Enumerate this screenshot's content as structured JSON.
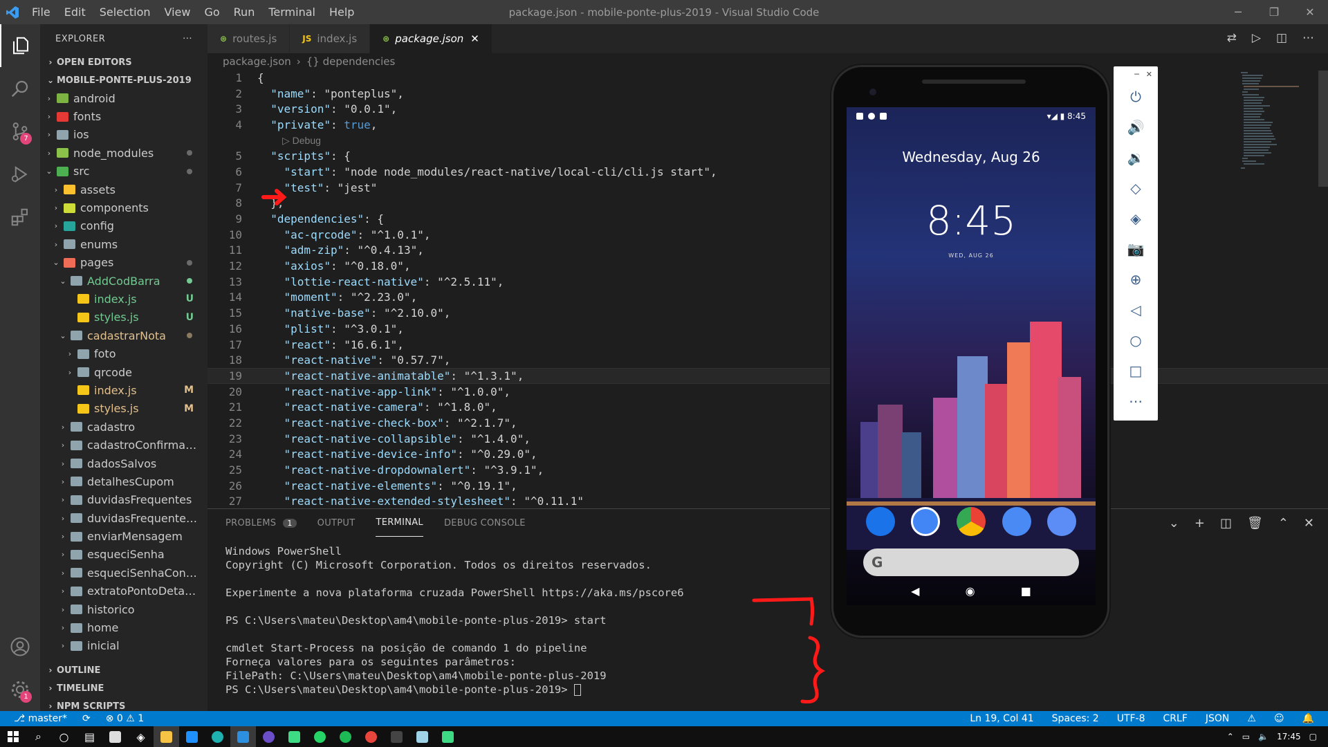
{
  "window": {
    "title": "package.json - mobile-ponte-plus-2019 - Visual Studio Code",
    "menu": [
      "File",
      "Edit",
      "Selection",
      "View",
      "Go",
      "Run",
      "Terminal",
      "Help"
    ]
  },
  "activity": {
    "scm_badge": "7",
    "settings_badge": "1"
  },
  "explorer": {
    "title": "EXPLORER",
    "more": "···",
    "open_editors": "OPEN EDITORS",
    "project": "MOBILE-PONTE-PLUS-2019",
    "tree": [
      {
        "label": "android",
        "depth": 1,
        "chev": "›",
        "icon": "#7cb342",
        "status": ""
      },
      {
        "label": "fonts",
        "depth": 1,
        "chev": "›",
        "icon": "#e53935",
        "status": ""
      },
      {
        "label": "ios",
        "depth": 1,
        "chev": "›",
        "icon": "#90a4ae",
        "status": ""
      },
      {
        "label": "node_modules",
        "depth": 1,
        "chev": "›",
        "icon": "#8bc34a",
        "status": "",
        "dot": true
      },
      {
        "label": "src",
        "depth": 1,
        "chev": "⌄",
        "icon": "#4caf50",
        "status": "",
        "dot": true
      },
      {
        "label": "assets",
        "depth": 2,
        "chev": "›",
        "icon": "#fbc02d",
        "status": ""
      },
      {
        "label": "components",
        "depth": 2,
        "chev": "›",
        "icon": "#cddc39",
        "status": ""
      },
      {
        "label": "config",
        "depth": 2,
        "chev": "›",
        "icon": "#26a69a",
        "status": ""
      },
      {
        "label": "enums",
        "depth": 2,
        "chev": "›",
        "icon": "#90a4ae",
        "status": ""
      },
      {
        "label": "pages",
        "depth": 2,
        "chev": "⌄",
        "icon": "#ef6c57",
        "status": "",
        "dot": true
      },
      {
        "label": "AddCodBarra",
        "depth": 3,
        "chev": "⌄",
        "icon": "#90a4ae",
        "status": "",
        "green": true,
        "dot": true
      },
      {
        "label": "index.js",
        "depth": 4,
        "chev": "",
        "icon": "#f5c518",
        "status": "U",
        "green": true
      },
      {
        "label": "styles.js",
        "depth": 4,
        "chev": "",
        "icon": "#f5c518",
        "status": "U",
        "green": true
      },
      {
        "label": "cadastrarNota",
        "depth": 3,
        "chev": "⌄",
        "icon": "#90a4ae",
        "status": "",
        "mod": true,
        "dot": true
      },
      {
        "label": "foto",
        "depth": 4,
        "chev": "›",
        "icon": "#90a4ae",
        "status": ""
      },
      {
        "label": "qrcode",
        "depth": 4,
        "chev": "›",
        "icon": "#90a4ae",
        "status": ""
      },
      {
        "label": "index.js",
        "depth": 4,
        "chev": "",
        "icon": "#f5c518",
        "status": "M",
        "mod": true
      },
      {
        "label": "styles.js",
        "depth": 4,
        "chev": "",
        "icon": "#f5c518",
        "status": "M",
        "mod": true
      },
      {
        "label": "cadastro",
        "depth": 3,
        "chev": "›",
        "icon": "#90a4ae",
        "status": ""
      },
      {
        "label": "cadastroConfirmacao",
        "depth": 3,
        "chev": "›",
        "icon": "#90a4ae",
        "status": ""
      },
      {
        "label": "dadosSalvos",
        "depth": 3,
        "chev": "›",
        "icon": "#90a4ae",
        "status": ""
      },
      {
        "label": "detalhesCupom",
        "depth": 3,
        "chev": "›",
        "icon": "#90a4ae",
        "status": ""
      },
      {
        "label": "duvidasFrequentes",
        "depth": 3,
        "chev": "›",
        "icon": "#90a4ae",
        "status": ""
      },
      {
        "label": "duvidasFrequentesIn...",
        "depth": 3,
        "chev": "›",
        "icon": "#90a4ae",
        "status": ""
      },
      {
        "label": "enviarMensagem",
        "depth": 3,
        "chev": "›",
        "icon": "#90a4ae",
        "status": ""
      },
      {
        "label": "esqueciSenha",
        "depth": 3,
        "chev": "›",
        "icon": "#90a4ae",
        "status": ""
      },
      {
        "label": "esqueciSenhaConfir...",
        "depth": 3,
        "chev": "›",
        "icon": "#90a4ae",
        "status": ""
      },
      {
        "label": "extratoPontoDetalhes",
        "depth": 3,
        "chev": "›",
        "icon": "#90a4ae",
        "status": ""
      },
      {
        "label": "historico",
        "depth": 3,
        "chev": "›",
        "icon": "#90a4ae",
        "status": ""
      },
      {
        "label": "home",
        "depth": 3,
        "chev": "›",
        "icon": "#90a4ae",
        "status": ""
      },
      {
        "label": "inicial",
        "depth": 3,
        "chev": "›",
        "icon": "#90a4ae",
        "status": ""
      }
    ],
    "outline": "OUTLINE",
    "timeline": "TIMELINE",
    "npm": "NPM SCRIPTS"
  },
  "tabs": [
    {
      "label": "routes.js",
      "icon": "⊛",
      "color": "#8bc34a",
      "active": false
    },
    {
      "label": "index.js",
      "icon": "JS",
      "color": "#f5c518",
      "active": false
    },
    {
      "label": "package.json",
      "icon": "⊛",
      "color": "#8bc34a",
      "active": true
    }
  ],
  "breadcrumb": [
    "package.json",
    "{} dependencies"
  ],
  "codelens": "▷ Debug",
  "code": [
    "{",
    "  \"name\": \"ponteplus\",",
    "  \"version\": \"0.0.1\",",
    "  \"private\": true,",
    "  \"scripts\": {",
    "    \"start\": \"node node_modules/react-native/local-cli/cli.js start\",",
    "    \"test\": \"jest\"",
    "  },",
    "  \"dependencies\": {",
    "    \"ac-qrcode\": \"^1.0.1\",",
    "    \"adm-zip\": \"^0.4.13\",",
    "    \"axios\": \"^0.18.0\",",
    "    \"lottie-react-native\": \"^2.5.11\",",
    "    \"moment\": \"^2.23.0\",",
    "    \"native-base\": \"^2.10.0\",",
    "    \"plist\": \"^3.0.1\",",
    "    \"react\": \"16.6.1\",",
    "    \"react-native\": \"0.57.7\",",
    "    \"react-native-animatable\": \"^1.3.1\",",
    "    \"react-native-app-link\": \"^1.0.0\",",
    "    \"react-native-camera\": \"^1.8.0\",",
    "    \"react-native-check-box\": \"^2.1.7\",",
    "    \"react-native-collapsible\": \"^1.4.0\",",
    "    \"react-native-device-info\": \"^0.29.0\",",
    "    \"react-native-dropdownalert\": \"^3.9.1\",",
    "    \"react-native-elements\": \"^0.19.1\",",
    "    \"react-native-extended-stylesheet\": \"^0.11.1\""
  ],
  "current_line": 19,
  "panel": {
    "tabs": [
      "PROBLEMS",
      "OUTPUT",
      "TERMINAL",
      "DEBUG CONSOLE"
    ],
    "problems_count": "1",
    "terminal": [
      "Windows PowerShell",
      "Copyright (C) Microsoft Corporation. Todos os direitos reservados.",
      "",
      "Experimente a nova plataforma cruzada PowerShell https://aka.ms/pscore6",
      "",
      "PS C:\\Users\\mateu\\Desktop\\am4\\mobile-ponte-plus-2019> start",
      "",
      "cmdlet Start-Process na posição de comando 1 do pipeline",
      "Forneça valores para os seguintes parâmetros:",
      "FilePath: C:\\Users\\mateu\\Desktop\\am4\\mobile-ponte-plus-2019"
    ],
    "prompt": "PS C:\\Users\\mateu\\Desktop\\am4\\mobile-ponte-plus-2019> "
  },
  "status": {
    "branch": "master*",
    "errors": "0",
    "warnings": "1",
    "position": "Ln 19, Col 41",
    "spaces": "Spaces: 2",
    "encoding": "UTF-8",
    "eol": "CRLF",
    "language": "JSON"
  },
  "phone": {
    "time": "8:45",
    "date": "Wednesday, Aug 26",
    "clock": "8:45",
    "small_date": "WED, AUG 26",
    "search_g": "G"
  },
  "taskbar": {
    "time": "17:45"
  }
}
